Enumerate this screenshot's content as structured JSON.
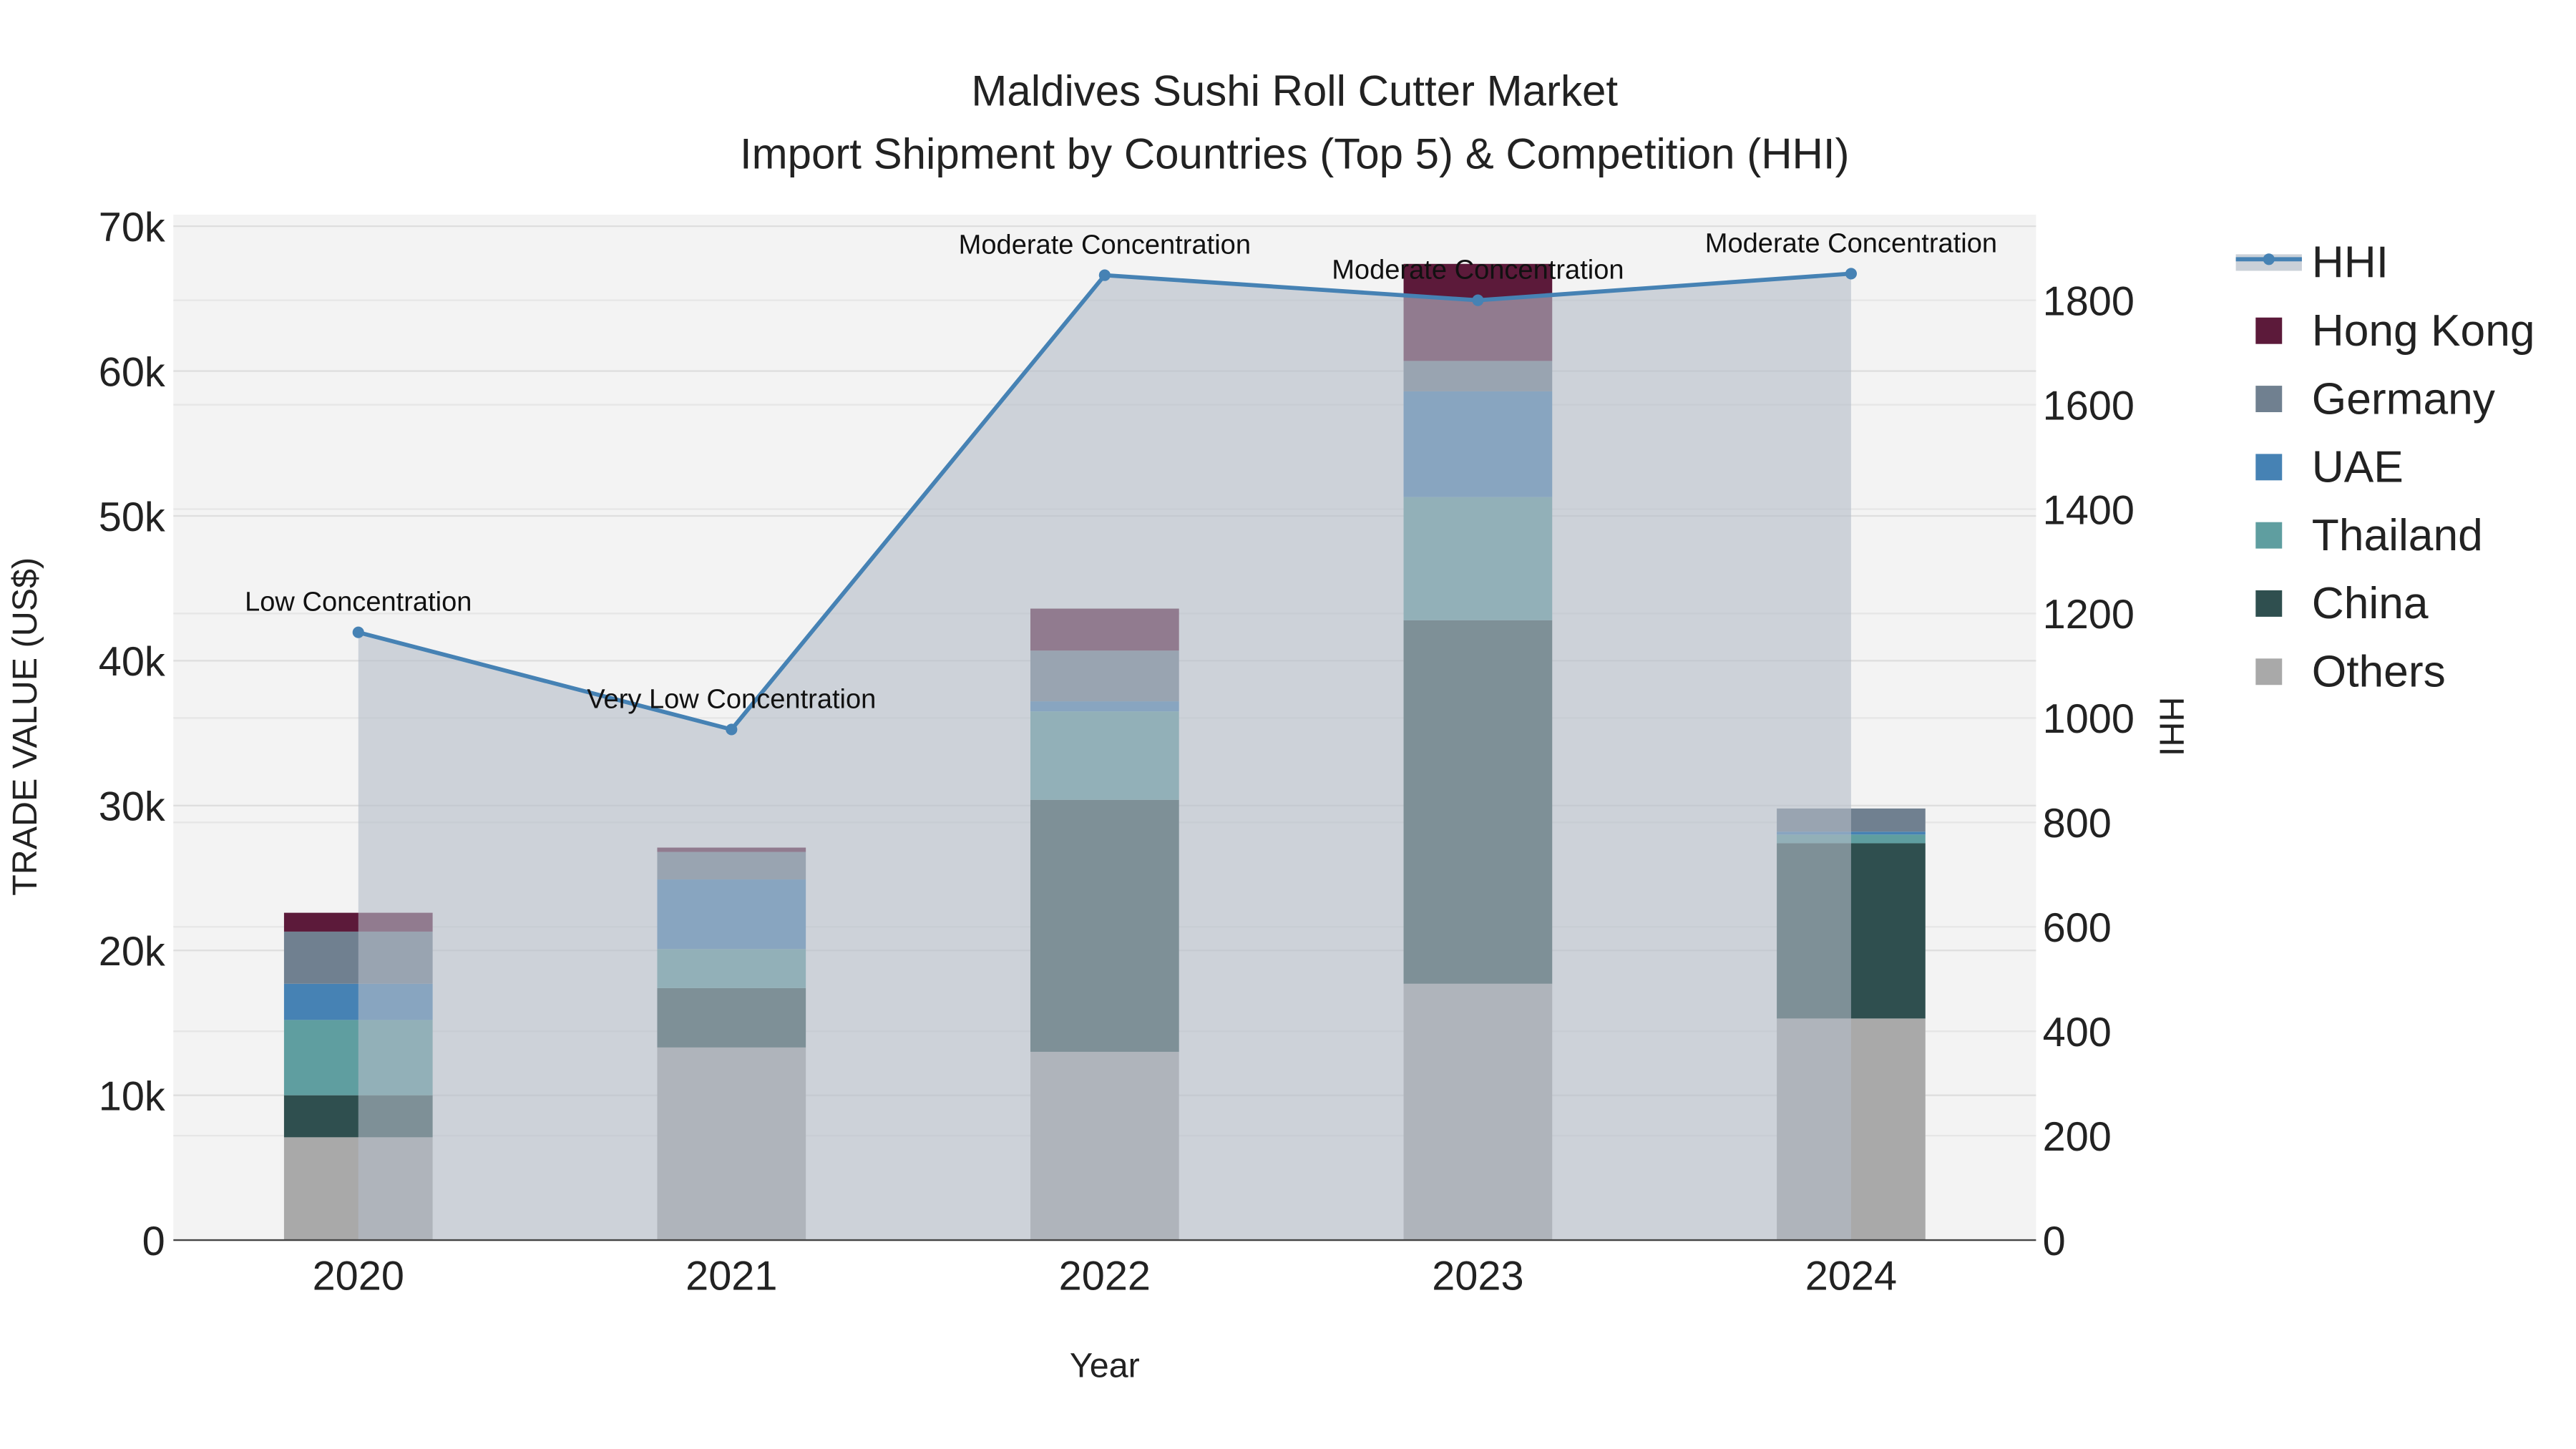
{
  "chart_data": {
    "type": "bar",
    "stacked": true,
    "title": "Maldives Sushi Roll Cutter Market",
    "subtitle": "Import Shipment by Countries (Top 5) & Competition (HHI)",
    "xlabel": "Year",
    "ylabel": "TRADE VALUE (US$)",
    "y2label": "HHI",
    "categories": [
      "2020",
      "2021",
      "2022",
      "2023",
      "2024"
    ],
    "ylim": [
      0,
      70000
    ],
    "yticks": [
      0,
      10000,
      20000,
      30000,
      40000,
      50000,
      60000,
      70000
    ],
    "ytick_labels": [
      "0",
      "10k",
      "20k",
      "30k",
      "40k",
      "50k",
      "60k",
      "70k"
    ],
    "y2lim": [
      0,
      1950
    ],
    "y2ticks": [
      0,
      200,
      400,
      600,
      800,
      1000,
      1200,
      1400,
      1600,
      1800
    ],
    "y2tick_labels": [
      "0",
      "200",
      "400",
      "600",
      "800",
      "1000",
      "1200",
      "1400",
      "1600",
      "1800"
    ],
    "series": [
      {
        "name": "Others",
        "color": "#a9a9a9",
        "values": [
          7100,
          13300,
          13000,
          17700,
          15300
        ]
      },
      {
        "name": "China",
        "color": "#2f4f4f",
        "values": [
          2900,
          4100,
          17400,
          25100,
          12100
        ]
      },
      {
        "name": "Thailand",
        "color": "#5f9ea0",
        "values": [
          5200,
          2700,
          6100,
          8500,
          600
        ]
      },
      {
        "name": "UAE",
        "color": "#4682b4",
        "values": [
          2500,
          4800,
          700,
          7300,
          200
        ]
      },
      {
        "name": "Germany",
        "color": "#708090",
        "values": [
          3600,
          1900,
          3500,
          2100,
          1600
        ]
      },
      {
        "name": "Hong Kong",
        "color": "#5c1a3a",
        "values": [
          1300,
          300,
          2900,
          6700,
          0
        ]
      }
    ],
    "hhi": {
      "name": "HHI",
      "color": "#4682b4",
      "values": [
        1164,
        978,
        1848,
        1800,
        1851
      ],
      "annotations": [
        "Low Concentration",
        "Very Low Concentration",
        "Moderate Concentration",
        "Moderate Concentration",
        "Moderate Concentration"
      ]
    },
    "legend": [
      "HHI",
      "Hong Kong",
      "Germany",
      "UAE",
      "Thailand",
      "China",
      "Others"
    ],
    "legend_position": "right",
    "grid": true
  }
}
